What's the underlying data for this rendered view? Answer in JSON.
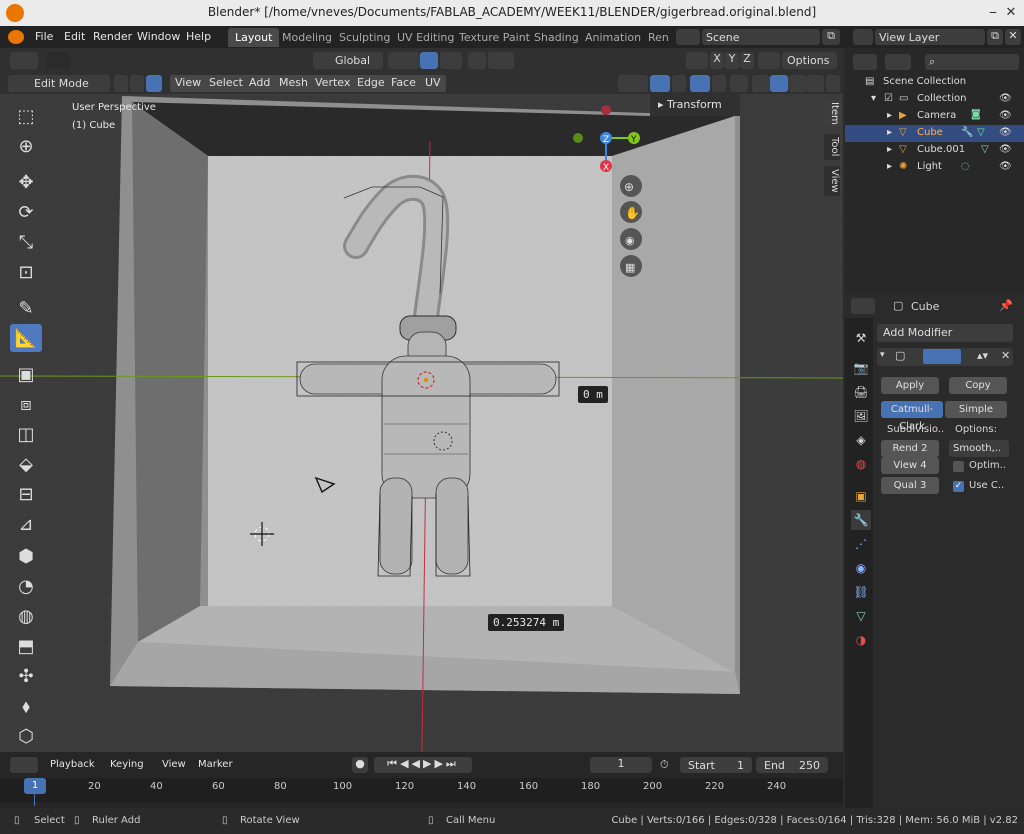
{
  "window": {
    "title": "Blender* [/home/vneves/Documents/FABLAB_ACADEMY/WEEK11/BLENDER/gigerbread.original.blend]"
  },
  "menu": [
    "File",
    "Edit",
    "Render",
    "Window",
    "Help"
  ],
  "workspaces": [
    "Layout",
    "Modeling",
    "Sculpting",
    "UV Editing",
    "Texture Paint",
    "Shading",
    "Animation",
    "Ren"
  ],
  "scene": {
    "label": "Scene",
    "view_layer": "View Layer"
  },
  "header": {
    "orientation": "Global",
    "options": "Options",
    "axes": [
      "X",
      "Y",
      "Z"
    ],
    "mode": "Edit Mode",
    "menus": [
      "View",
      "Select",
      "Add",
      "Mesh",
      "Vertex",
      "Edge",
      "Face",
      "UV"
    ]
  },
  "viewport": {
    "perspective": "User Perspective",
    "object": "(1) Cube",
    "transform_panel": "Transform",
    "side_tabs": [
      "Item",
      "Tool",
      "View"
    ],
    "measure_main": "0.253274 m",
    "measure_small": "0 m",
    "gizmo_axes": [
      "X",
      "Y",
      "Z"
    ]
  },
  "outliner": {
    "scene_collection": "Scene Collection",
    "items": [
      {
        "label": "Collection",
        "level": 1
      },
      {
        "label": "Camera",
        "level": 2
      },
      {
        "label": "Cube",
        "level": 2,
        "selected": true
      },
      {
        "label": "Cube.001",
        "level": 2
      },
      {
        "label": "Light",
        "level": 2
      }
    ]
  },
  "properties": {
    "object": "Cube",
    "add_modifier": "Add Modifier",
    "apply": "Apply",
    "copy": "Copy",
    "catmull": "Catmull-Clark",
    "simple": "Simple",
    "subdivisions": "Subdivisio..",
    "options": "Options:",
    "render": "Rend  2",
    "view": "View  4",
    "quality": "Qual  3",
    "smooth": "Smooth,..",
    "optim": "Optim..",
    "use_c": "Use C.."
  },
  "timeline": {
    "menus": [
      "Playback",
      "Keying",
      "View",
      "Marker"
    ],
    "current": "1",
    "start_label": "Start",
    "start": "1",
    "end_label": "End",
    "end": "250",
    "ticks": [
      "1",
      "20",
      "40",
      "60",
      "80",
      "100",
      "120",
      "140",
      "160",
      "180",
      "200",
      "220",
      "240"
    ]
  },
  "status": {
    "select": "Select",
    "ruler": "Ruler Add",
    "rotate": "Rotate View",
    "call": "Call Menu",
    "stats": "Cube | Verts:0/166 | Edges:0/328 | Faces:0/164 | Tris:328 | Mem: 56.0 MiB | v2.82"
  },
  "colors": {
    "accent": "#4772b3",
    "selection": "#334d80",
    "x_axis": "#e0364a",
    "y_axis": "#82c71d",
    "z_axis": "#3d87e0"
  }
}
